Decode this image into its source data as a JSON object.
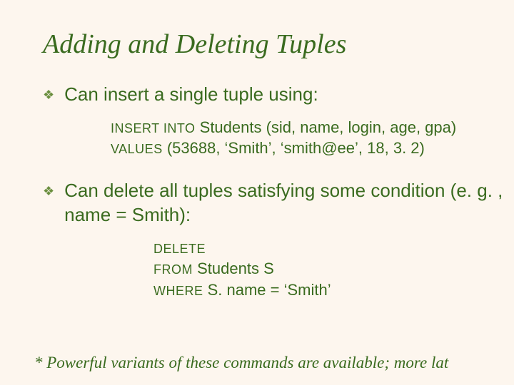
{
  "title": "Adding and Deleting Tuples",
  "bullets": [
    {
      "text": "Can insert a single tuple using:"
    },
    {
      "text": "Can delete all tuples satisfying some condition (e. g. , name = Smith):"
    }
  ],
  "code1": {
    "kw_insert": "INSERT INTO",
    "insert_rest": " Students (sid, name, login, age, gpa)",
    "kw_values": "VALUES",
    "values_rest": "  (53688, ‘Smith’, ‘smith@ee’, 18, 3. 2)"
  },
  "code2": {
    "kw_delete": "DELETE",
    "kw_from": "FROM",
    "from_rest": " Students S",
    "kw_where": "WHERE",
    "where_rest": " S. name = ‘Smith’"
  },
  "footnote": "* Powerful variants of these commands are available; more lat",
  "bullet_glyph": "❖"
}
